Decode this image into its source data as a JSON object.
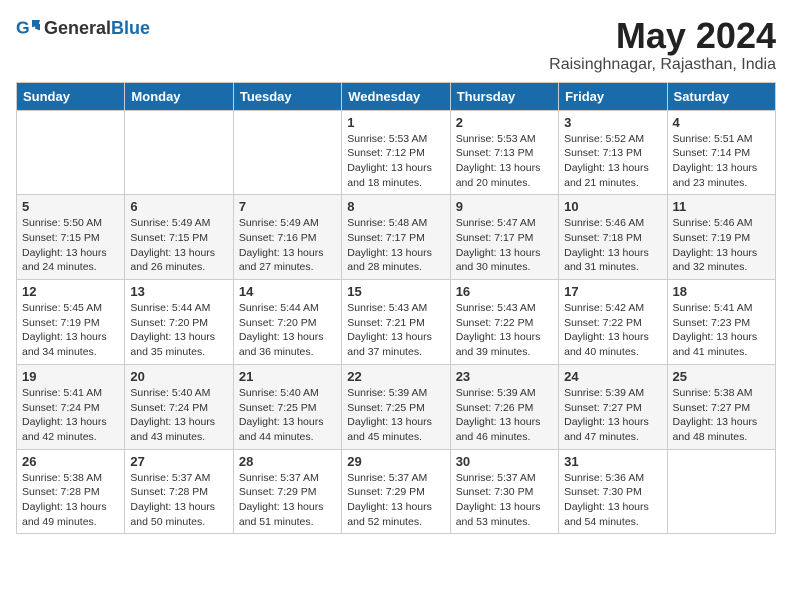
{
  "header": {
    "logo_general": "General",
    "logo_blue": "Blue",
    "month_title": "May 2024",
    "location": "Raisinghnagar, Rajasthan, India"
  },
  "weekdays": [
    "Sunday",
    "Monday",
    "Tuesday",
    "Wednesday",
    "Thursday",
    "Friday",
    "Saturday"
  ],
  "weeks": [
    [
      {
        "day": "",
        "info": ""
      },
      {
        "day": "",
        "info": ""
      },
      {
        "day": "",
        "info": ""
      },
      {
        "day": "1",
        "info": "Sunrise: 5:53 AM\nSunset: 7:12 PM\nDaylight: 13 hours\nand 18 minutes."
      },
      {
        "day": "2",
        "info": "Sunrise: 5:53 AM\nSunset: 7:13 PM\nDaylight: 13 hours\nand 20 minutes."
      },
      {
        "day": "3",
        "info": "Sunrise: 5:52 AM\nSunset: 7:13 PM\nDaylight: 13 hours\nand 21 minutes."
      },
      {
        "day": "4",
        "info": "Sunrise: 5:51 AM\nSunset: 7:14 PM\nDaylight: 13 hours\nand 23 minutes."
      }
    ],
    [
      {
        "day": "5",
        "info": "Sunrise: 5:50 AM\nSunset: 7:15 PM\nDaylight: 13 hours\nand 24 minutes."
      },
      {
        "day": "6",
        "info": "Sunrise: 5:49 AM\nSunset: 7:15 PM\nDaylight: 13 hours\nand 26 minutes."
      },
      {
        "day": "7",
        "info": "Sunrise: 5:49 AM\nSunset: 7:16 PM\nDaylight: 13 hours\nand 27 minutes."
      },
      {
        "day": "8",
        "info": "Sunrise: 5:48 AM\nSunset: 7:17 PM\nDaylight: 13 hours\nand 28 minutes."
      },
      {
        "day": "9",
        "info": "Sunrise: 5:47 AM\nSunset: 7:17 PM\nDaylight: 13 hours\nand 30 minutes."
      },
      {
        "day": "10",
        "info": "Sunrise: 5:46 AM\nSunset: 7:18 PM\nDaylight: 13 hours\nand 31 minutes."
      },
      {
        "day": "11",
        "info": "Sunrise: 5:46 AM\nSunset: 7:19 PM\nDaylight: 13 hours\nand 32 minutes."
      }
    ],
    [
      {
        "day": "12",
        "info": "Sunrise: 5:45 AM\nSunset: 7:19 PM\nDaylight: 13 hours\nand 34 minutes."
      },
      {
        "day": "13",
        "info": "Sunrise: 5:44 AM\nSunset: 7:20 PM\nDaylight: 13 hours\nand 35 minutes."
      },
      {
        "day": "14",
        "info": "Sunrise: 5:44 AM\nSunset: 7:20 PM\nDaylight: 13 hours\nand 36 minutes."
      },
      {
        "day": "15",
        "info": "Sunrise: 5:43 AM\nSunset: 7:21 PM\nDaylight: 13 hours\nand 37 minutes."
      },
      {
        "day": "16",
        "info": "Sunrise: 5:43 AM\nSunset: 7:22 PM\nDaylight: 13 hours\nand 39 minutes."
      },
      {
        "day": "17",
        "info": "Sunrise: 5:42 AM\nSunset: 7:22 PM\nDaylight: 13 hours\nand 40 minutes."
      },
      {
        "day": "18",
        "info": "Sunrise: 5:41 AM\nSunset: 7:23 PM\nDaylight: 13 hours\nand 41 minutes."
      }
    ],
    [
      {
        "day": "19",
        "info": "Sunrise: 5:41 AM\nSunset: 7:24 PM\nDaylight: 13 hours\nand 42 minutes."
      },
      {
        "day": "20",
        "info": "Sunrise: 5:40 AM\nSunset: 7:24 PM\nDaylight: 13 hours\nand 43 minutes."
      },
      {
        "day": "21",
        "info": "Sunrise: 5:40 AM\nSunset: 7:25 PM\nDaylight: 13 hours\nand 44 minutes."
      },
      {
        "day": "22",
        "info": "Sunrise: 5:39 AM\nSunset: 7:25 PM\nDaylight: 13 hours\nand 45 minutes."
      },
      {
        "day": "23",
        "info": "Sunrise: 5:39 AM\nSunset: 7:26 PM\nDaylight: 13 hours\nand 46 minutes."
      },
      {
        "day": "24",
        "info": "Sunrise: 5:39 AM\nSunset: 7:27 PM\nDaylight: 13 hours\nand 47 minutes."
      },
      {
        "day": "25",
        "info": "Sunrise: 5:38 AM\nSunset: 7:27 PM\nDaylight: 13 hours\nand 48 minutes."
      }
    ],
    [
      {
        "day": "26",
        "info": "Sunrise: 5:38 AM\nSunset: 7:28 PM\nDaylight: 13 hours\nand 49 minutes."
      },
      {
        "day": "27",
        "info": "Sunrise: 5:37 AM\nSunset: 7:28 PM\nDaylight: 13 hours\nand 50 minutes."
      },
      {
        "day": "28",
        "info": "Sunrise: 5:37 AM\nSunset: 7:29 PM\nDaylight: 13 hours\nand 51 minutes."
      },
      {
        "day": "29",
        "info": "Sunrise: 5:37 AM\nSunset: 7:29 PM\nDaylight: 13 hours\nand 52 minutes."
      },
      {
        "day": "30",
        "info": "Sunrise: 5:37 AM\nSunset: 7:30 PM\nDaylight: 13 hours\nand 53 minutes."
      },
      {
        "day": "31",
        "info": "Sunrise: 5:36 AM\nSunset: 7:30 PM\nDaylight: 13 hours\nand 54 minutes."
      },
      {
        "day": "",
        "info": ""
      }
    ]
  ]
}
